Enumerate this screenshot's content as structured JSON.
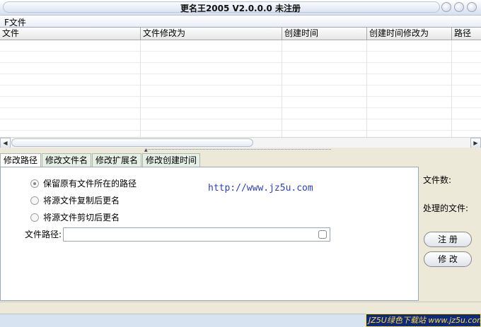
{
  "window": {
    "title": "更名王2005 V2.0.0.0 未注册"
  },
  "menu": {
    "file": "F文件"
  },
  "table": {
    "columns": [
      "文件",
      "文件修改为",
      "创建时间",
      "创建时间修改为",
      "路径"
    ]
  },
  "tabs": [
    "修改路径",
    "修改文件名",
    "修改扩展名",
    "修改创建时间"
  ],
  "panel": {
    "options": [
      "保留原有文件所在的路径",
      "将源文件复制后更名",
      "将源文件剪切后更名"
    ],
    "selected_option": 0,
    "url": "http://www.jz5u.com",
    "path_label": "文件路径:",
    "path_value": ""
  },
  "side": {
    "file_count_label": "文件数:",
    "processed_label": "处理的文件:",
    "register_button": "注 册",
    "modify_button": "修 改"
  },
  "status": {
    "watermark": "JZ5U绿色下载站 www.jz5u.com"
  },
  "colors": {
    "url": "#2b3fc4",
    "watermark_bg": "#0f2a7a",
    "watermark_text": "#ffd93b"
  }
}
